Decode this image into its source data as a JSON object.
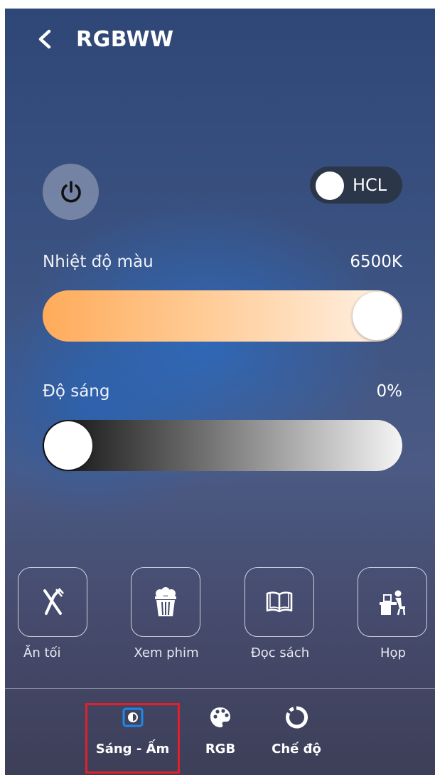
{
  "header": {
    "title": "RGBWW",
    "back_icon": "chevron-left-icon"
  },
  "controls": {
    "power_icon": "power-icon",
    "hcl_label": "HCL"
  },
  "temperature": {
    "label": "Nhiệt độ màu",
    "value": "6500K",
    "level": 1.0
  },
  "brightness": {
    "label": "Độ sáng",
    "value": "0%",
    "level": 0.0
  },
  "scenes": [
    {
      "label": "Ăn tối",
      "icon": "fork-knife-icon"
    },
    {
      "label": "Xem phim",
      "icon": "popcorn-icon"
    },
    {
      "label": "Đọc sách",
      "icon": "book-icon"
    },
    {
      "label": "Họp",
      "icon": "desk-person-icon"
    }
  ],
  "tabs": [
    {
      "label": "Sáng - Ấm",
      "icon": "warm-light-icon",
      "active": true
    },
    {
      "label": "RGB",
      "icon": "palette-icon",
      "active": false
    },
    {
      "label": "Chế độ",
      "icon": "ring-icon",
      "active": false
    }
  ],
  "colors": {
    "accent": "#1e88e5",
    "highlight": "#e0202a"
  }
}
